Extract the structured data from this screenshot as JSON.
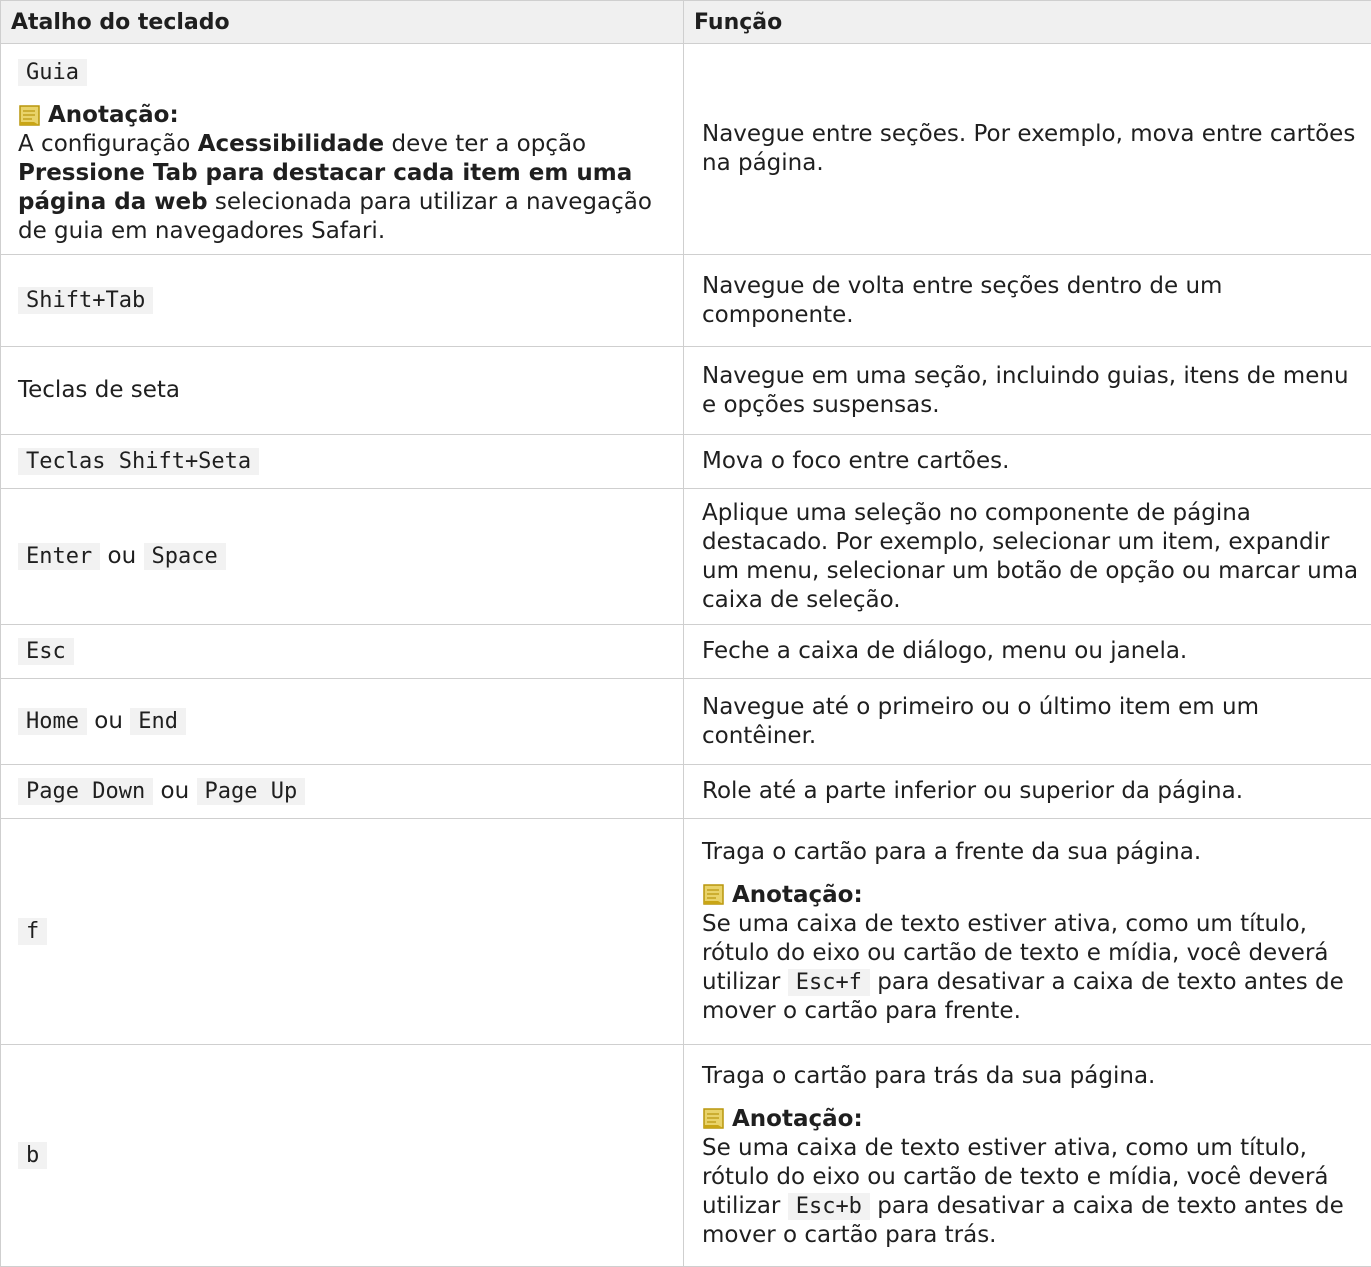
{
  "headers": {
    "shortcut": "Atalho do teclado",
    "function": "Função"
  },
  "note_label": "Anotação:",
  "or_text": "ou",
  "rows": [
    {
      "key": "Guia",
      "note_text_1": "A configuração ",
      "note_bold_1": "Acessibilidade",
      "note_text_2": " deve ter a opção ",
      "note_bold_2": "Pressione Tab para destacar cada item em uma página da web",
      "note_text_3": " selecionada para utilizar a navegação de guia em navegadores Safari.",
      "func": "Navegue entre seções. Por exemplo, mova entre cartões na página."
    },
    {
      "key": "Shift+Tab",
      "func": "Navegue de volta entre seções dentro de um componente."
    },
    {
      "key": "Teclas de seta",
      "func": "Navegue em uma seção, incluindo guias, itens de menu e opções suspensas."
    },
    {
      "key": "Teclas Shift+Seta",
      "func": "Mova o foco entre cartões."
    },
    {
      "key_a": "Enter",
      "key_b": "Space",
      "func": "Aplique uma seleção no componente de página destacado. Por exemplo, selecionar um item, expandir um menu, selecionar um botão de opção ou marcar uma caixa de seleção."
    },
    {
      "key": "Esc",
      "func": "Feche a caixa de diálogo, menu ou janela."
    },
    {
      "key_a": "Home",
      "key_b": "End",
      "func": "Navegue até o primeiro ou o último item em um contêiner."
    },
    {
      "key_a": "Page Down",
      "key_b": "Page Up",
      "func": "Role até a parte inferior ou superior da página."
    },
    {
      "key": "f",
      "func": "Traga o cartão para a frente da sua página.",
      "note_text_1": "Se uma caixa de texto estiver ativa, como um título, rótulo do eixo ou cartão de texto e mídia, você deverá utilizar ",
      "note_code": "Esc+f",
      "note_text_2": " para desativar a caixa de texto antes de mover o cartão para frente."
    },
    {
      "key": "b",
      "func": "Traga o cartão para trás da sua página.",
      "note_text_1": "Se uma caixa de texto estiver ativa, como um título, rótulo do eixo ou cartão de texto e mídia, você deverá utilizar ",
      "note_code": "Esc+b",
      "note_text_2": " para desativar a caixa de texto antes de mover o cartão para trás."
    }
  ]
}
